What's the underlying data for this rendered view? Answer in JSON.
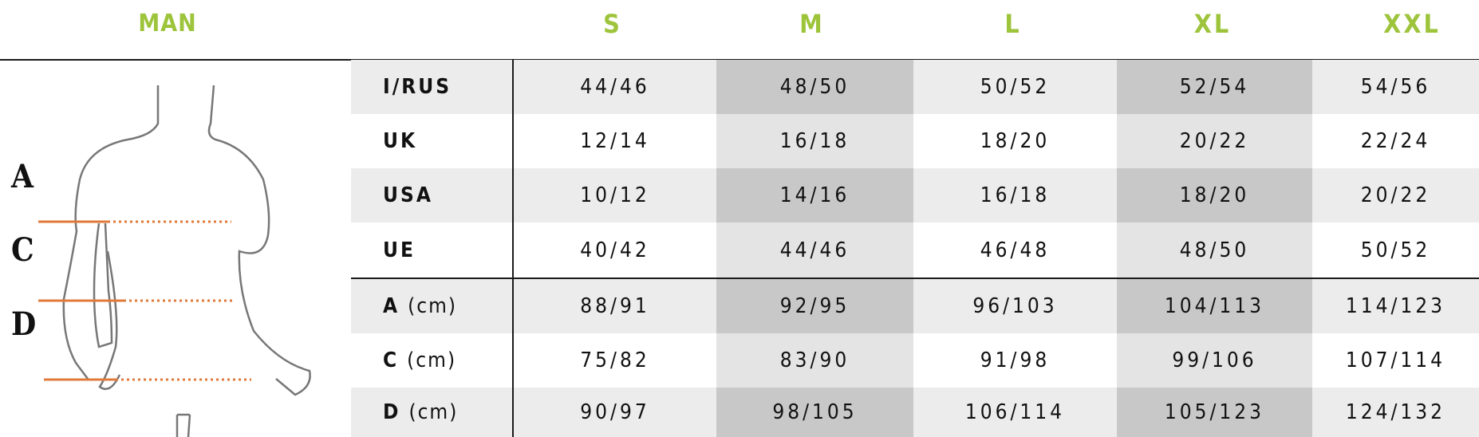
{
  "header": {
    "title": "MAN",
    "sizes": [
      "S",
      "M",
      "L",
      "XL",
      "XXL"
    ]
  },
  "rows": [
    {
      "label": "I/RUS",
      "unit": "",
      "values": [
        "44/46",
        "48/50",
        "50/52",
        "52/54",
        "54/56"
      ]
    },
    {
      "label": "UK",
      "unit": "",
      "values": [
        "12/14",
        "16/18",
        "18/20",
        "20/22",
        "22/24"
      ]
    },
    {
      "label": "USA",
      "unit": "",
      "values": [
        "10/12",
        "14/16",
        "16/18",
        "18/20",
        "20/22"
      ]
    },
    {
      "label": "UE",
      "unit": "",
      "values": [
        "40/42",
        "44/46",
        "46/48",
        "48/50",
        "50/52"
      ]
    },
    {
      "label": "A",
      "unit": "(cm)",
      "values": [
        "88/91",
        "92/95",
        "96/103",
        "104/113",
        "114/123"
      ]
    },
    {
      "label": "C",
      "unit": "(cm)",
      "values": [
        "75/82",
        "83/90",
        "91/98",
        "99/106",
        "107/114"
      ]
    },
    {
      "label": "D",
      "unit": "(cm)",
      "values": [
        "90/97",
        "98/105",
        "106/114",
        "105/123",
        "124/132"
      ]
    }
  ],
  "figure": {
    "markers": [
      "A",
      "C",
      "D"
    ]
  },
  "colors": {
    "accent_green": "#9dc43b",
    "measure_orange": "#e07a3a",
    "row_light": "#ececec",
    "row_white": "#ffffff",
    "col_dark": "#c8c8c8",
    "col_mid": "#e4e4e4"
  }
}
